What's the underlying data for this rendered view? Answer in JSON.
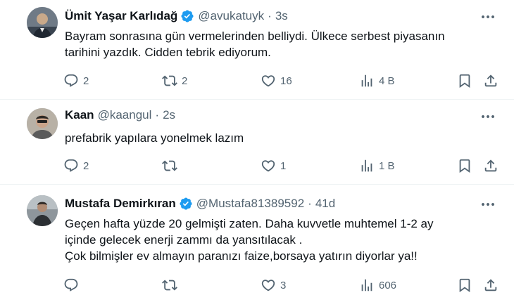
{
  "tweets": [
    {
      "name": "Ümit Yaşar Karlıdağ",
      "verified": true,
      "handle": "@avukatuyk",
      "time": "3s",
      "text_lines": [
        "Bayram sonrasına gün vermelerinden belliydi. Ülkece serbest piyasanın",
        "tarihini yazdık. Cidden tebrik ediyorum."
      ],
      "replies": "2",
      "retweets": "2",
      "likes": "16",
      "views": "4 B"
    },
    {
      "name": "Kaan",
      "verified": false,
      "handle": "@kaangul",
      "time": "2s",
      "text_lines": [
        "prefabrik yapılara yonelmek lazım"
      ],
      "replies": "2",
      "retweets": "",
      "likes": "1",
      "views": "1 B"
    },
    {
      "name": "Mustafa Demirkıran",
      "verified": true,
      "handle": "@Mustafa81389592",
      "time": "41d",
      "text_lines": [
        "Geçen hafta yüzde 20 gelmişti zaten. Daha  kuvvetle muhtemel 1-2 ay",
        "içinde gelecek enerji zammı da yansıtılacak .",
        "Çok bilmişler ev almayın paranızı faize,borsaya yatırın diyorlar ya!!"
      ],
      "replies": "",
      "retweets": "",
      "likes": "3",
      "views": "606"
    }
  ],
  "separator": "·",
  "colors": {
    "verified": "#1d9bf0",
    "secondary_text": "#536471",
    "text": "#0f1419"
  },
  "icons": [
    "reply-icon",
    "retweet-icon",
    "like-icon",
    "views-icon",
    "bookmark-icon",
    "share-icon",
    "more-icon",
    "verified-badge-icon"
  ]
}
